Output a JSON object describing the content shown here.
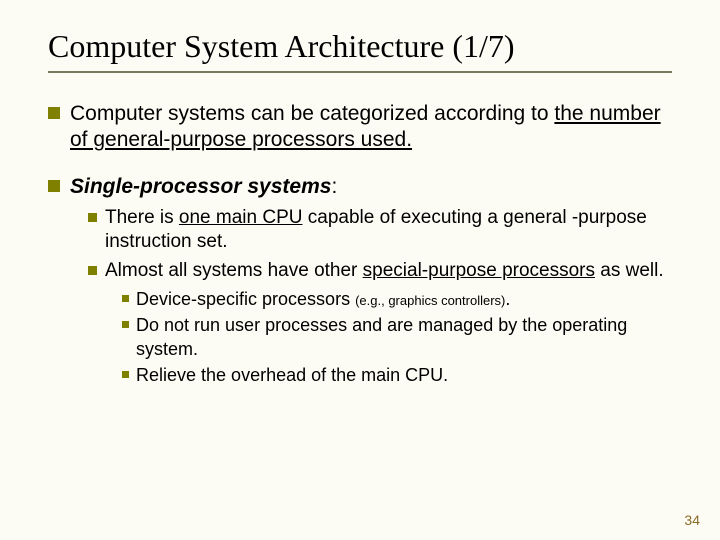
{
  "title": "Computer System Architecture (1/7)",
  "b1": {
    "pre": "Computer systems can be categorized according to ",
    "under": "the number of general-purpose processors used."
  },
  "b2": {
    "heading_bi": "Single-processor systems",
    "colon": ":",
    "sub1": {
      "pre": "There is ",
      "under": "one main CPU",
      "post": " capable of executing a general -purpose instruction set."
    },
    "sub2": {
      "pre": "Almost all systems have other ",
      "under": "special-purpose processors",
      "post": " as well."
    },
    "notes": {
      "n1_pre": "Device-specific processors ",
      "n1_paren": "(e.g., graphics controllers)",
      "n1_dot": ".",
      "n2": "Do not run user processes and are managed by the operating system.",
      "n3": "Relieve the overhead of the main CPU."
    }
  },
  "page": "34"
}
